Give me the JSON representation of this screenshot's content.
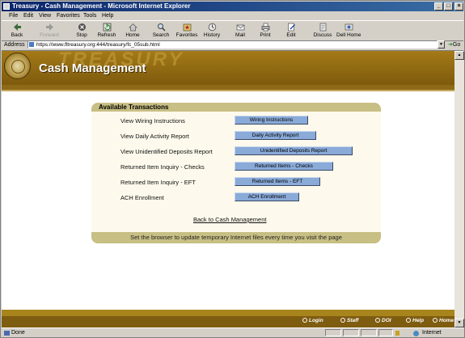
{
  "window": {
    "title": "Treasury - Cash Management - Microsoft Internet Explorer",
    "controls": [
      "_",
      "□",
      "×"
    ]
  },
  "menu": [
    "File",
    "Edit",
    "View",
    "Favorites",
    "Tools",
    "Help"
  ],
  "toolbar": {
    "back": "Back",
    "forward": "Forward",
    "stop": "Stop",
    "refresh": "Refresh",
    "home": "Home",
    "search": "Search",
    "favorites": "Favorites",
    "history": "History",
    "mail": "Mail",
    "print": "Print",
    "edit": "Edit",
    "discuss": "Discuss",
    "dellhome": "Dell Home"
  },
  "address": {
    "label": "Address",
    "url": "https://www.fltreasury.org:444/treasury/fc_05sub.html",
    "go": "Go"
  },
  "page": {
    "banner_watermark": "TREASURY",
    "title": "Cash Management",
    "panel": {
      "header": "Available Transactions",
      "rows": [
        {
          "label": "View Wiring Instructions",
          "button": "Wiring Instructions"
        },
        {
          "label": "View Daily Activity Report",
          "button": "Daily Activity Report"
        },
        {
          "label": "View Unidentified Deposits Report",
          "button": "Unidentified Deposits Report"
        },
        {
          "label": "Returned Item Inquiry - Checks",
          "button": "Returned Items - Checks"
        },
        {
          "label": "Returned Item Inquiry - EFT",
          "button": "Returned Items - EFT"
        },
        {
          "label": "ACH Enrollment",
          "button": "ACH Enrollment"
        }
      ],
      "back_link": "Back to Cash Management",
      "footer": "Set the browser to update temporary Internet files every time you visit the page"
    }
  },
  "bottom_nav": [
    "Login",
    "Staff",
    "DOI",
    "Help",
    "Home"
  ],
  "status": {
    "text": "Done",
    "zone": "Internet"
  },
  "colors": {
    "banner_gold": "#a47a18",
    "panel_header": "#c8bf84",
    "panel_bg": "#fdf9ec",
    "button_blue": "#8aaad8",
    "titlebar": "#0a246a"
  }
}
